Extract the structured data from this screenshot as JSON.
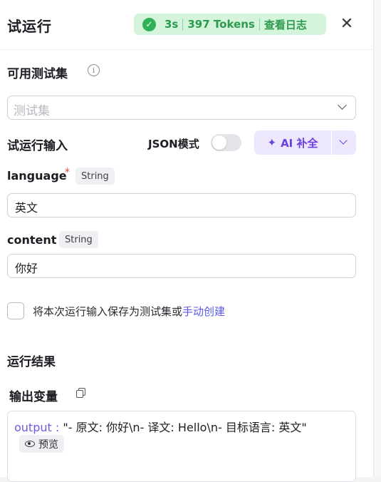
{
  "header": {
    "title": "试运行",
    "status_icon": "check-circle-icon",
    "duration": "3s",
    "tokens": "397 Tokens",
    "view_log": "查看日志",
    "close_icon": "close-icon"
  },
  "test_set": {
    "label": "可用测试集",
    "info_icon": "info-icon",
    "placeholder": "测试集"
  },
  "run_input": {
    "label": "试运行输入",
    "json_mode_label": "JSON模式",
    "json_mode_on": false,
    "ai_complete_label": "AI 补全",
    "ai_icon": "sparkle-icon"
  },
  "fields": [
    {
      "name": "language",
      "required": "*",
      "type": "String",
      "value": "英文"
    },
    {
      "name": "content",
      "type": "String",
      "value": "你好"
    }
  ],
  "save_option": {
    "checked": false,
    "text": "将本次运行输入保存为测试集或",
    "link": "手动创建"
  },
  "result": {
    "label": "运行结果",
    "output_label": "输出变量",
    "copy_icon": "copy-icon",
    "output_key": "output :",
    "output_value": "\"-  原文: 你好\\n-  译文: Hello\\n-  目标语言: 英文\"",
    "preview_label": "预览",
    "preview_icon": "eye-icon"
  },
  "colors": {
    "accent": "#6b3fe0",
    "success": "#2e9a4e",
    "success_bg": "#d4f4dc",
    "required": "#e0473a",
    "link": "#5a5ae0"
  }
}
